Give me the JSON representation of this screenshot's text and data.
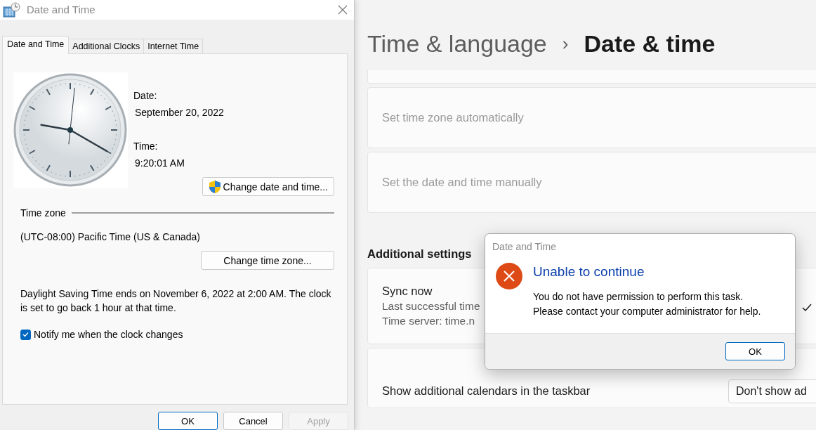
{
  "date_time_window": {
    "title": "Date and Time",
    "tabs": [
      {
        "label": "Date and Time",
        "selected": true
      },
      {
        "label": "Additional Clocks",
        "selected": false
      },
      {
        "label": "Internet Time",
        "selected": false
      }
    ],
    "date_label": "Date:",
    "date": "September 20, 2022",
    "time_label": "Time:",
    "time": "9:20:01 AM",
    "change_date_button": "Change date and time...",
    "time_zone_heading": "Time zone",
    "time_zone": "(UTC-08:00) Pacific Time (US & Canada)",
    "change_zone_button": "Change time zone...",
    "dst_note": "Daylight Saving Time ends on November 6, 2022 at 2:00 AM. The clock is set to go back 1 hour at that time.",
    "notify": {
      "label": "Notify me when the clock changes",
      "checked": true
    },
    "buttons": [
      {
        "label": "OK",
        "kind": "default",
        "disabled": false
      },
      {
        "label": "Cancel",
        "kind": "normal",
        "disabled": false
      },
      {
        "label": "Apply",
        "kind": "normal",
        "disabled": true
      }
    ]
  },
  "settings_page": {
    "breadcrumb": {
      "parent": "Time & language",
      "separator": "›",
      "current": "Date & time"
    },
    "cards": [
      {
        "kind": "toggle",
        "label": "Set time zone automatically",
        "disabled": true
      },
      {
        "kind": "toggle",
        "label": "Set the date and time manually",
        "disabled": true
      }
    ],
    "section_heading": "Additional settings",
    "sync_card": {
      "title": "Sync now",
      "lines": [
        "Last successful time",
        "Time server: time.n"
      ]
    },
    "calendar_card": {
      "label": "Show additional calendars in the taskbar",
      "dropdown": "Don't show ad"
    }
  },
  "error_dialog": {
    "title": "Date and Time",
    "heading": "Unable to continue",
    "message": [
      "You do not have permission to perform this task.",
      "Please contact your computer administrator for help."
    ],
    "button": "OK"
  }
}
